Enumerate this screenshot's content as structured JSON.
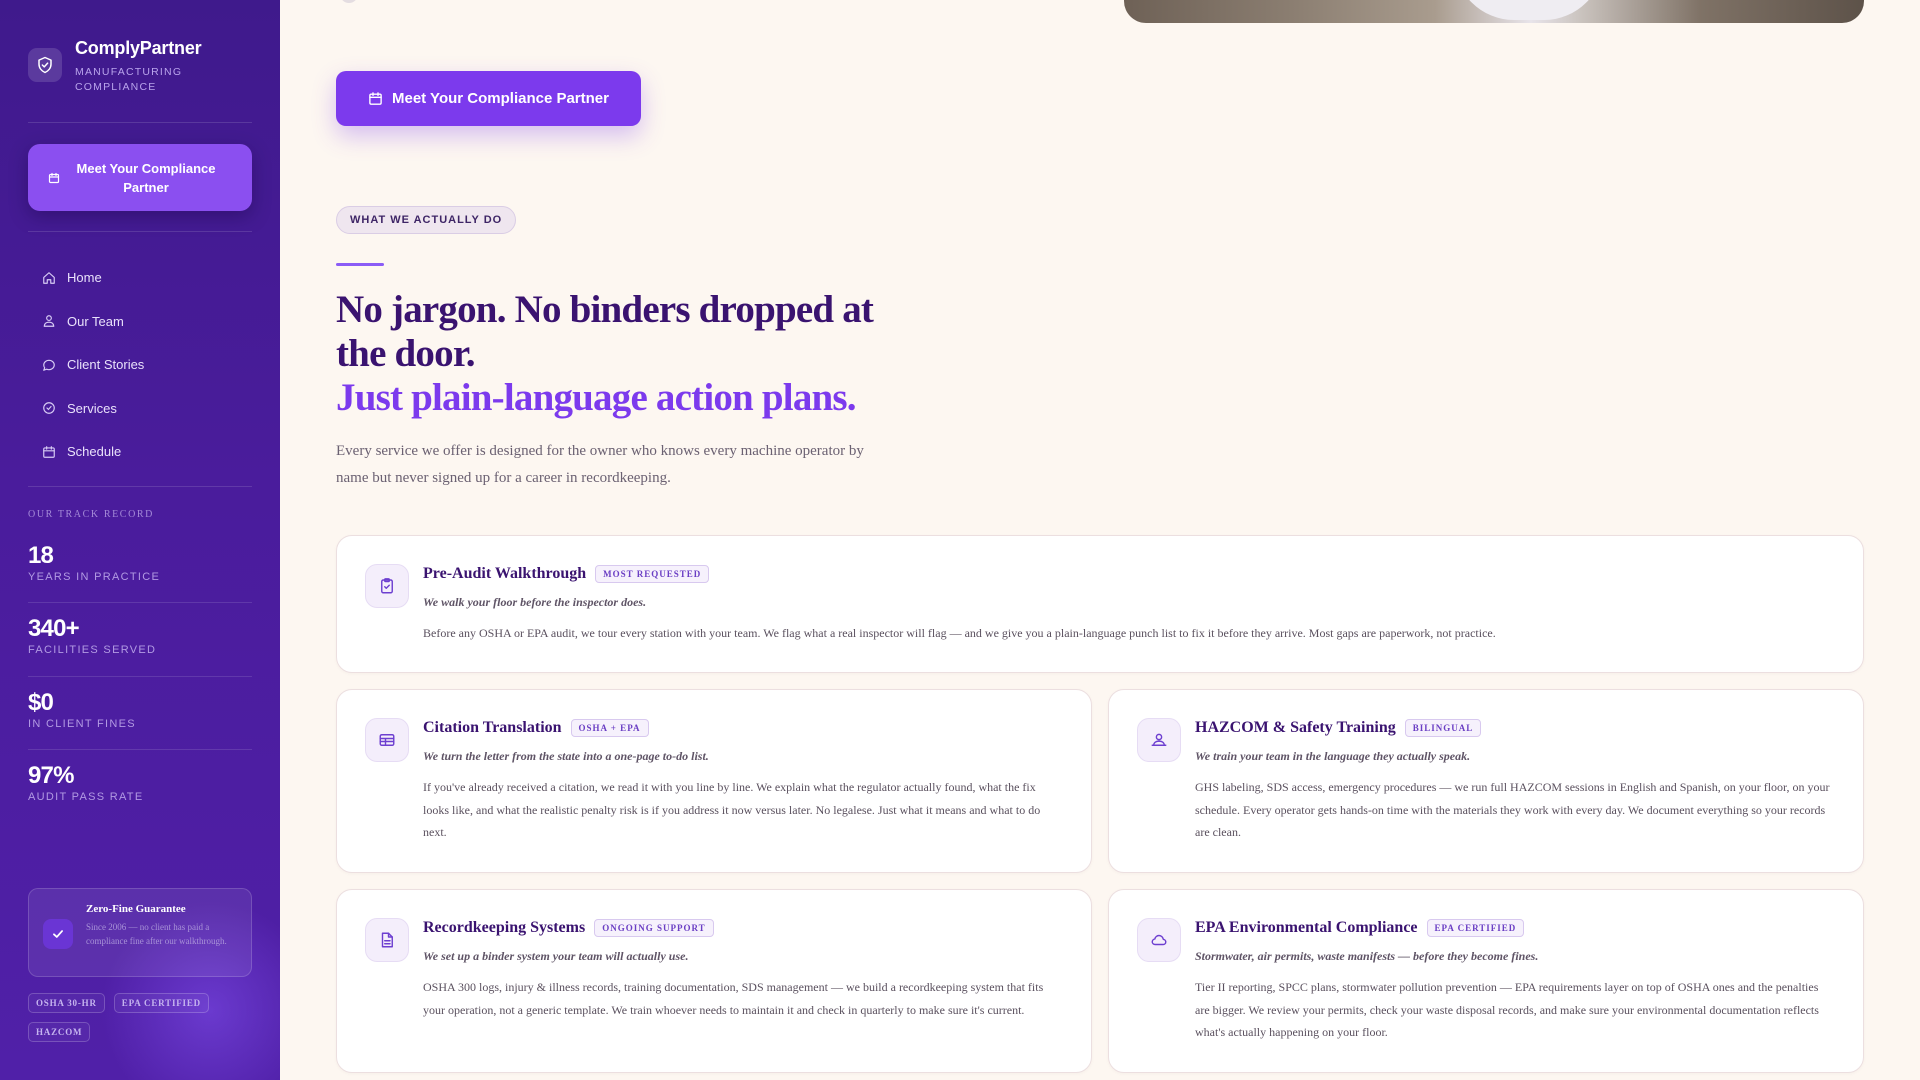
{
  "brand": {
    "name": "ComplyPartner",
    "subtitle": "MANUFACTURING COMPLIANCE"
  },
  "sidebar": {
    "cta_label": "Meet Your Compliance Partner",
    "nav": [
      {
        "label": "Home",
        "icon": "home-icon"
      },
      {
        "label": "Our Team",
        "icon": "team-icon"
      },
      {
        "label": "Client Stories",
        "icon": "chat-icon"
      },
      {
        "label": "Services",
        "icon": "check-circle-icon"
      },
      {
        "label": "Schedule",
        "icon": "calendar-icon"
      }
    ],
    "track_title": "OUR TRACK RECORD",
    "stats": [
      {
        "value": "18",
        "label": "YEARS IN PRACTICE"
      },
      {
        "value": "340+",
        "label": "FACILITIES SERVED"
      },
      {
        "value": "$0",
        "label": "IN CLIENT FINES"
      },
      {
        "value": "97%",
        "label": "AUDIT PASS RATE"
      }
    ],
    "guarantee": {
      "title": "Zero-Fine Guarantee",
      "text": "Since 2006 — no client has paid a compliance fine after our walkthrough."
    },
    "tags": [
      "OSHA 30-HR",
      "EPA CERTIFIED",
      "HAZCOM"
    ]
  },
  "main": {
    "cta_label": "Meet Your Compliance Partner",
    "eyebrow": "WHAT WE ACTUALLY DO",
    "headline_line1": "No jargon. No binders dropped at the door.",
    "headline_line2": "Just plain-language action plans.",
    "lede": "Every service we offer is designed for the owner who knows every machine operator by name but never signed up for a career in recordkeeping."
  },
  "services": [
    {
      "title": "Pre-Audit Walkthrough",
      "badge": "MOST REQUESTED",
      "icon": "clipboard-check-icon",
      "tagline": "We walk your floor before the inspector does.",
      "body": "Before any OSHA or EPA audit, we tour every station with your team. We flag what a real inspector will flag — and we give you a plain-language punch list to fix it before they arrive. Most gaps are paperwork, not practice."
    },
    {
      "title": "Citation Translation",
      "badge": "OSHA + EPA",
      "icon": "document-list-icon",
      "tagline": "We turn the letter from the state into a one-page to-do list.",
      "body": "If you've already received a citation, we read it with you line by line. We explain what the regulator actually found, what the fix looks like, and what the realistic penalty risk is if you address it now versus later. No legalese. Just what it means and what to do next."
    },
    {
      "title": "HAZCOM & Safety Training",
      "badge": "BILINGUAL",
      "icon": "trainer-icon",
      "tagline": "We train your team in the language they actually speak.",
      "body": "GHS labeling, SDS access, emergency procedures — we run full HAZCOM sessions in English and Spanish, on your floor, on your schedule. Every operator gets hands-on time with the materials they work with every day. We document everything so your records are clean."
    },
    {
      "title": "Recordkeeping Systems",
      "badge": "ONGOING SUPPORT",
      "icon": "file-icon",
      "tagline": "We set up a binder system your team will actually use.",
      "body": "OSHA 300 logs, injury & illness records, training documentation, SDS management — we build a recordkeeping system that fits your operation, not a generic template. We train whoever needs to maintain it and check in quarterly to make sure it's current."
    },
    {
      "title": "EPA Environmental Compliance",
      "badge": "EPA CERTIFIED",
      "icon": "cloud-icon",
      "tagline": "Stormwater, air permits, waste manifests — before they become fines.",
      "body": "Tier II reporting, SPCC plans, stormwater pollution prevention — EPA requirements layer on top of OSHA ones and the penalties are bigger. We review your permits, check your waste disposal records, and make sure your environmental documentation reflects what's actually happening on your floor."
    }
  ]
}
